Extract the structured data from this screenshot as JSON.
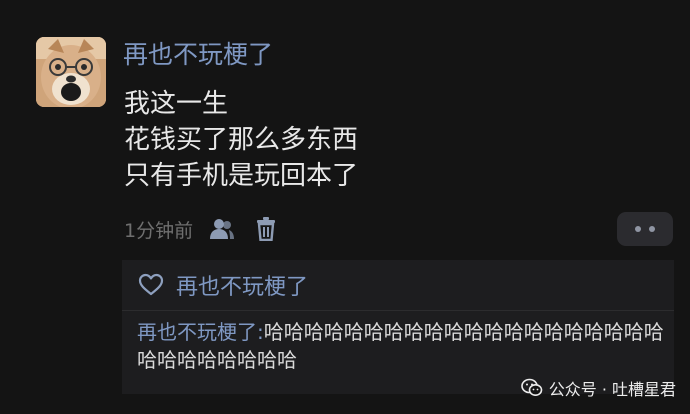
{
  "post": {
    "author": "再也不玩梗了",
    "lines": [
      "我这一生",
      "花钱买了那么多东西",
      "只有手机是玩回本了"
    ],
    "time": "1分钟前"
  },
  "icons": {
    "avatar": "dog-with-glasses-avatar",
    "user": "user-icon",
    "delete": "trash-icon",
    "more": "more-dots-icon",
    "like": "heart-outline-icon",
    "watermark": "wechat-icon"
  },
  "likes": {
    "names": "再也不玩梗了"
  },
  "reply": {
    "author": "再也不玩梗了:",
    "text": "哈哈哈哈哈哈哈哈哈哈哈哈哈哈哈哈哈哈哈哈哈哈哈哈哈哈哈哈"
  },
  "watermark": {
    "text": "公众号 · 吐槽星君"
  },
  "colors": {
    "background": "#141414",
    "name": "#7f98c3",
    "text": "#e8e8e8",
    "meta": "#6f6f6f",
    "reply_bg": "#1d1d1f"
  }
}
